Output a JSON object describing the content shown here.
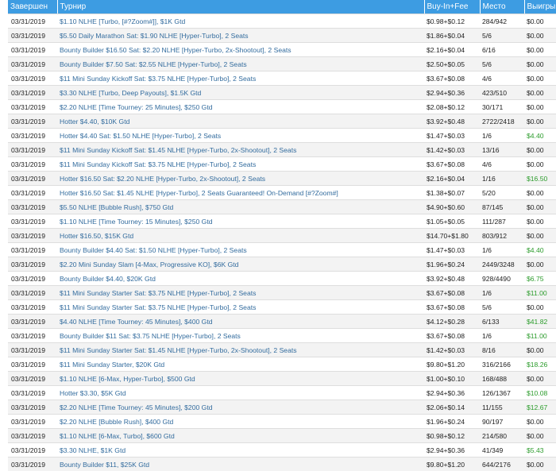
{
  "headers": {
    "date": "Завершен",
    "tournament": "Турнир",
    "buyin": "Buy-In+Fee",
    "place": "Место",
    "winnings": "Выигрыш"
  },
  "rows": [
    {
      "date": "03/31/2019",
      "tournament": "$1.10 NLHE [Turbo, [#?Zoom#]], $1K Gtd",
      "buyin": "$0.98+$0.12",
      "place": "284/942",
      "winnings": "$0.00",
      "positive": false
    },
    {
      "date": "03/31/2019",
      "tournament": "$5.50 Daily Marathon Sat: $1.90 NLHE [Hyper-Turbo], 2 Seats",
      "buyin": "$1.86+$0.04",
      "place": "5/6",
      "winnings": "$0.00",
      "positive": false
    },
    {
      "date": "03/31/2019",
      "tournament": "Bounty Builder $16.50 Sat: $2.20 NLHE [Hyper-Turbo, 2x-Shootout], 2 Seats",
      "buyin": "$2.16+$0.04",
      "place": "6/16",
      "winnings": "$0.00",
      "positive": false
    },
    {
      "date": "03/31/2019",
      "tournament": "Bounty Builder $7.50 Sat: $2.55 NLHE [Hyper-Turbo], 2 Seats",
      "buyin": "$2.50+$0.05",
      "place": "5/6",
      "winnings": "$0.00",
      "positive": false
    },
    {
      "date": "03/31/2019",
      "tournament": "$11 Mini Sunday Kickoff Sat: $3.75 NLHE [Hyper-Turbo], 2 Seats",
      "buyin": "$3.67+$0.08",
      "place": "4/6",
      "winnings": "$0.00",
      "positive": false
    },
    {
      "date": "03/31/2019",
      "tournament": "$3.30 NLHE [Turbo, Deep Payouts], $1.5K Gtd",
      "buyin": "$2.94+$0.36",
      "place": "423/510",
      "winnings": "$0.00",
      "positive": false
    },
    {
      "date": "03/31/2019",
      "tournament": "$2.20 NLHE [Time Tourney: 25 Minutes], $250 Gtd",
      "buyin": "$2.08+$0.12",
      "place": "30/171",
      "winnings": "$0.00",
      "positive": false
    },
    {
      "date": "03/31/2019",
      "tournament": "Hotter $4.40, $10K Gtd",
      "buyin": "$3.92+$0.48",
      "place": "2722/2418",
      "winnings": "$0.00",
      "positive": false
    },
    {
      "date": "03/31/2019",
      "tournament": "Hotter $4.40 Sat: $1.50 NLHE [Hyper-Turbo], 2 Seats",
      "buyin": "$1.47+$0.03",
      "place": "1/6",
      "winnings": "$4.40",
      "positive": true
    },
    {
      "date": "03/31/2019",
      "tournament": "$11 Mini Sunday Kickoff Sat: $1.45 NLHE [Hyper-Turbo, 2x-Shootout], 2 Seats",
      "buyin": "$1.42+$0.03",
      "place": "13/16",
      "winnings": "$0.00",
      "positive": false
    },
    {
      "date": "03/31/2019",
      "tournament": "$11 Mini Sunday Kickoff Sat: $3.75 NLHE [Hyper-Turbo], 2 Seats",
      "buyin": "$3.67+$0.08",
      "place": "4/6",
      "winnings": "$0.00",
      "positive": false
    },
    {
      "date": "03/31/2019",
      "tournament": "Hotter $16.50 Sat: $2.20 NLHE [Hyper-Turbo, 2x-Shootout], 2 Seats",
      "buyin": "$2.16+$0.04",
      "place": "1/16",
      "winnings": "$16.50",
      "positive": true
    },
    {
      "date": "03/31/2019",
      "tournament": "Hotter $16.50 Sat: $1.45 NLHE [Hyper-Turbo], 2 Seats Guaranteed! On-Demand [#?Zoom#]",
      "buyin": "$1.38+$0.07",
      "place": "5/20",
      "winnings": "$0.00",
      "positive": false
    },
    {
      "date": "03/31/2019",
      "tournament": "$5.50 NLHE [Bubble Rush], $750 Gtd",
      "buyin": "$4.90+$0.60",
      "place": "87/145",
      "winnings": "$0.00",
      "positive": false
    },
    {
      "date": "03/31/2019",
      "tournament": "$1.10 NLHE [Time Tourney: 15 Minutes], $250 Gtd",
      "buyin": "$1.05+$0.05",
      "place": "111/287",
      "winnings": "$0.00",
      "positive": false
    },
    {
      "date": "03/31/2019",
      "tournament": "Hotter $16.50, $15K Gtd",
      "buyin": "$14.70+$1.80",
      "place": "803/912",
      "winnings": "$0.00",
      "positive": false
    },
    {
      "date": "03/31/2019",
      "tournament": "Bounty Builder $4.40 Sat: $1.50 NLHE [Hyper-Turbo], 2 Seats",
      "buyin": "$1.47+$0.03",
      "place": "1/6",
      "winnings": "$4.40",
      "positive": true
    },
    {
      "date": "03/31/2019",
      "tournament": "$2.20 Mini Sunday Slam [4-Max, Progressive KO], $6K Gtd",
      "buyin": "$1.96+$0.24",
      "place": "2449/3248",
      "winnings": "$0.00",
      "positive": false
    },
    {
      "date": "03/31/2019",
      "tournament": "Bounty Builder $4.40, $20K Gtd",
      "buyin": "$3.92+$0.48",
      "place": "928/4490",
      "winnings": "$6.75",
      "positive": true
    },
    {
      "date": "03/31/2019",
      "tournament": "$11 Mini Sunday Starter Sat: $3.75 NLHE [Hyper-Turbo], 2 Seats",
      "buyin": "$3.67+$0.08",
      "place": "1/6",
      "winnings": "$11.00",
      "positive": true
    },
    {
      "date": "03/31/2019",
      "tournament": "$11 Mini Sunday Starter Sat: $3.75 NLHE [Hyper-Turbo], 2 Seats",
      "buyin": "$3.67+$0.08",
      "place": "5/6",
      "winnings": "$0.00",
      "positive": false
    },
    {
      "date": "03/31/2019",
      "tournament": "$4.40 NLHE [Time Tourney: 45 Minutes], $400 Gtd",
      "buyin": "$4.12+$0.28",
      "place": "6/133",
      "winnings": "$41.82",
      "positive": true
    },
    {
      "date": "03/31/2019",
      "tournament": "Bounty Builder $11 Sat: $3.75 NLHE [Hyper-Turbo], 2 Seats",
      "buyin": "$3.67+$0.08",
      "place": "1/6",
      "winnings": "$11.00",
      "positive": true
    },
    {
      "date": "03/31/2019",
      "tournament": "$11 Mini Sunday Starter Sat: $1.45 NLHE [Hyper-Turbo, 2x-Shootout], 2 Seats",
      "buyin": "$1.42+$0.03",
      "place": "8/16",
      "winnings": "$0.00",
      "positive": false
    },
    {
      "date": "03/31/2019",
      "tournament": "$11 Mini Sunday Starter, $20K Gtd",
      "buyin": "$9.80+$1.20",
      "place": "316/2166",
      "winnings": "$18.26",
      "positive": true
    },
    {
      "date": "03/31/2019",
      "tournament": "$1.10 NLHE [6-Max, Hyper-Turbo], $500 Gtd",
      "buyin": "$1.00+$0.10",
      "place": "168/488",
      "winnings": "$0.00",
      "positive": false
    },
    {
      "date": "03/31/2019",
      "tournament": "Hotter $3.30, $5K Gtd",
      "buyin": "$2.94+$0.36",
      "place": "126/1367",
      "winnings": "$10.08",
      "positive": true
    },
    {
      "date": "03/31/2019",
      "tournament": "$2.20 NLHE [Time Tourney: 45 Minutes], $200 Gtd",
      "buyin": "$2.06+$0.14",
      "place": "11/155",
      "winnings": "$12.67",
      "positive": true
    },
    {
      "date": "03/31/2019",
      "tournament": "$2.20 NLHE [Bubble Rush], $400 Gtd",
      "buyin": "$1.96+$0.24",
      "place": "90/197",
      "winnings": "$0.00",
      "positive": false
    },
    {
      "date": "03/31/2019",
      "tournament": "$1.10 NLHE [6-Max, Turbo], $600 Gtd",
      "buyin": "$0.98+$0.12",
      "place": "214/580",
      "winnings": "$0.00",
      "positive": false
    },
    {
      "date": "03/31/2019",
      "tournament": "$3.30 NLHE, $1K Gtd",
      "buyin": "$2.94+$0.36",
      "place": "41/349",
      "winnings": "$5.43",
      "positive": true
    },
    {
      "date": "03/31/2019",
      "tournament": "Bounty Builder $11, $25K Gtd",
      "buyin": "$9.80+$1.20",
      "place": "644/2176",
      "winnings": "$0.00",
      "positive": false
    }
  ]
}
